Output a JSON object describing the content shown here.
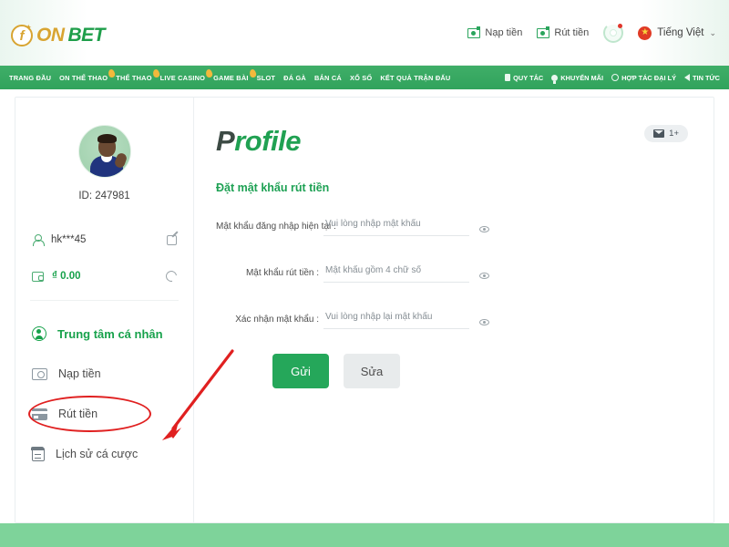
{
  "header": {
    "logo": {
      "mark": "f",
      "part1": "ON",
      "part2": "BET"
    },
    "links": [
      {
        "label": "Nạp tiền",
        "icon": "money-icon"
      },
      {
        "label": "Rút tiền",
        "icon": "money-icon"
      }
    ],
    "spinner": {
      "name": "loading-spinner-icon",
      "badge": true
    },
    "language": {
      "label": "Tiếng Việt",
      "flag": "★",
      "caret": "⌄"
    }
  },
  "nav": {
    "left": [
      {
        "label": "TRANG ĐẦU",
        "hot": false
      },
      {
        "label": "ON THỂ THAO",
        "hot": true
      },
      {
        "label": "THỂ THAO",
        "hot": true
      },
      {
        "label": "LIVE CASINO",
        "hot": true
      },
      {
        "label": "GAME BÀI",
        "hot": true
      },
      {
        "label": "SLOT",
        "hot": false
      },
      {
        "label": "ĐÁ GÀ",
        "hot": false
      },
      {
        "label": "BẮN CÁ",
        "hot": false
      },
      {
        "label": "XỔ SỐ",
        "hot": false
      },
      {
        "label": "KẾT QUẢ TRẬN ĐẤU",
        "hot": false
      }
    ],
    "right": [
      {
        "label": "QUY TẮC",
        "icon": "book-icon"
      },
      {
        "label": "KHUYẾN MÃI",
        "icon": "bulb-icon"
      },
      {
        "label": "HỢP TÁC ĐẠI LÝ",
        "icon": "handshake-icon"
      },
      {
        "label": "TIN TỨC",
        "icon": "speaker-icon"
      }
    ]
  },
  "sidebar": {
    "avatar_alt": "user-avatar",
    "user_id": "ID: 247981",
    "username": "hk***45",
    "balance": "₫ 0.00",
    "edit_action": "edit-profile-icon",
    "refresh_action": "refresh-balance-icon",
    "menu": [
      {
        "label": "Trung tâm cá nhân",
        "icon": "person-circle-icon",
        "active": true
      },
      {
        "label": "Nạp tiền",
        "icon": "deposit-icon",
        "active": false
      },
      {
        "label": "Rút tiền",
        "icon": "withdraw-card-icon",
        "active": false,
        "highlighted": true
      },
      {
        "label": "Lịch sử cá cược",
        "icon": "history-icon",
        "active": false
      }
    ]
  },
  "main": {
    "title_first": "P",
    "title_rest": "rofile",
    "section_title": "Đặt mật khẩu rút tiền",
    "mail_badge": {
      "icon": "envelope-icon",
      "count": "1+"
    },
    "fields": [
      {
        "label": "Mật khẩu đăng nhập hiện tại :",
        "placeholder": "Vui lòng nhập mật khẩu",
        "value": "",
        "toggle": "eye-icon"
      },
      {
        "label": "Mật khẩu rút tiền :",
        "placeholder": "Mật khẩu gồm 4 chữ số",
        "value": "",
        "toggle": "eye-icon"
      },
      {
        "label": "Xác nhận mật khẩu :",
        "placeholder": "Vui lòng nhập lại mật khẩu",
        "value": "",
        "toggle": "eye-icon"
      }
    ],
    "submit_label": "Gửi",
    "edit_label": "Sửa"
  },
  "annotation": {
    "color": "#e02020",
    "arrow": "points-to-withdraw-menu-item",
    "ellipse": "circles-withdraw-menu-item"
  },
  "colors": {
    "brand_green": "#31a35c",
    "accent_gold": "#d8a431",
    "active_green": "#18a24c",
    "footer_green": "#7ed39a",
    "annotation_red": "#e02020"
  }
}
